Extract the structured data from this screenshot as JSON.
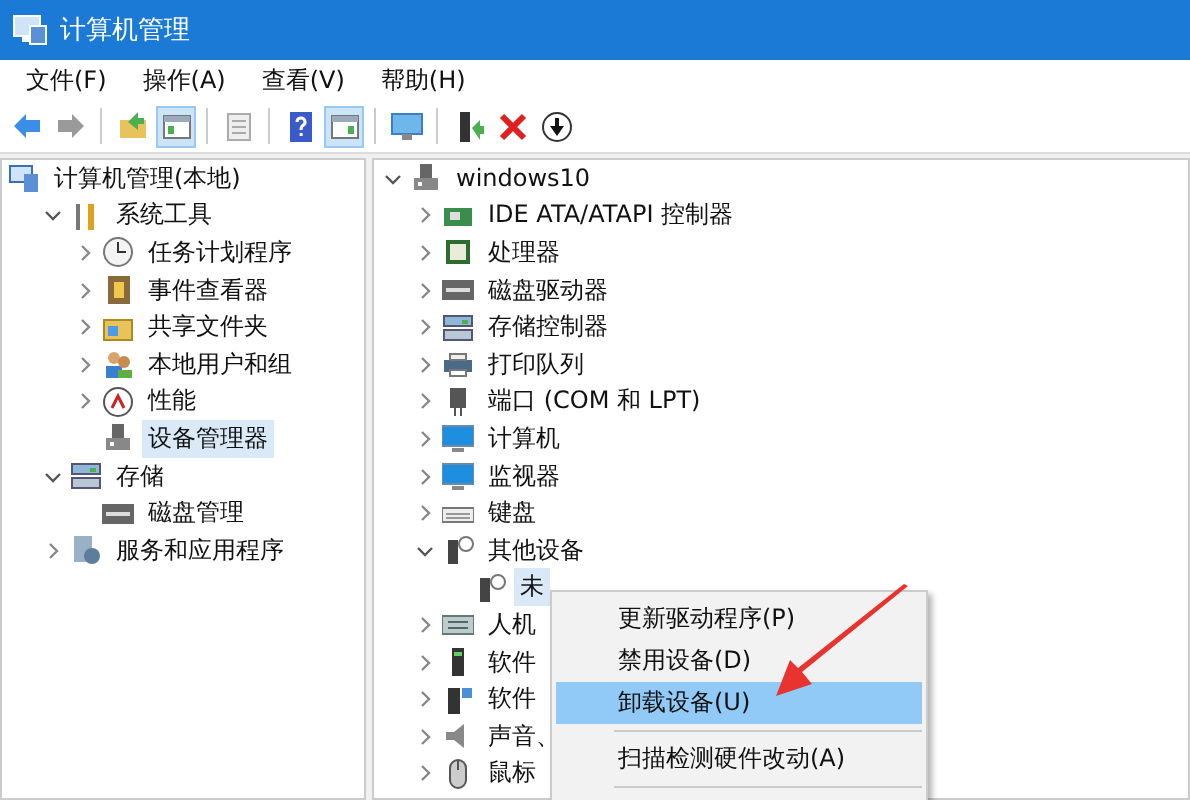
{
  "window": {
    "title": "计算机管理"
  },
  "menu": [
    "文件(F)",
    "操作(A)",
    "查看(V)",
    "帮助(H)"
  ],
  "toolbar": [
    {
      "pressed": false
    },
    {
      "pressed": false
    },
    {
      "pressed": false
    },
    {
      "pressed": true
    },
    {
      "pressed": false
    },
    {
      "pressed": false
    },
    {
      "pressed": true
    },
    {
      "pressed": false
    },
    {
      "pressed": false
    },
    {
      "pressed": false
    },
    {
      "pressed": false
    }
  ],
  "left_tree": [
    {
      "label": "计算机管理(本地)",
      "selected": false,
      "children": [
        {
          "label": "系统工具",
          "expanded": true,
          "selected": false,
          "children": [
            {
              "label": "任务计划程序",
              "expanded": false,
              "selected": false
            },
            {
              "label": "事件查看器",
              "expanded": false,
              "selected": false
            },
            {
              "label": "共享文件夹",
              "expanded": false,
              "selected": false
            },
            {
              "label": "本地用户和组",
              "expanded": false,
              "selected": false
            },
            {
              "label": "性能",
              "expanded": false,
              "selected": false
            },
            {
              "label": "设备管理器",
              "selected": true
            }
          ]
        },
        {
          "label": "存储",
          "expanded": true,
          "selected": false,
          "children": [
            {
              "label": "磁盘管理",
              "selected": false
            }
          ]
        },
        {
          "label": "服务和应用程序",
          "expanded": false,
          "selected": false
        }
      ]
    }
  ],
  "device_tree": [
    {
      "label": "windows10",
      "expanded": true,
      "selected": false,
      "children": [
        {
          "label": "IDE ATA/ATAPI 控制器",
          "expanded": false,
          "selected": false
        },
        {
          "label": "处理器",
          "expanded": false,
          "selected": false
        },
        {
          "label": "磁盘驱动器",
          "expanded": false,
          "selected": false
        },
        {
          "label": "存储控制器",
          "expanded": false,
          "selected": false
        },
        {
          "label": "打印队列",
          "expanded": false,
          "selected": false
        },
        {
          "label": "端口 (COM 和 LPT)",
          "expanded": false,
          "selected": false
        },
        {
          "label": "计算机",
          "expanded": false,
          "selected": false
        },
        {
          "label": "监视器",
          "expanded": false,
          "selected": false
        },
        {
          "label": "键盘",
          "expanded": false,
          "selected": false
        },
        {
          "label": "其他设备",
          "expanded": true,
          "selected": false,
          "children": [
            {
              "label": "未",
              "selected": true
            }
          ]
        },
        {
          "label": "人机",
          "expanded": false,
          "selected": false
        },
        {
          "label": "软件",
          "expanded": false,
          "selected": false
        },
        {
          "label": "软件",
          "expanded": false,
          "selected": false
        },
        {
          "label": "声音、",
          "expanded": false,
          "selected": false
        },
        {
          "label": "鼠标",
          "expanded": false,
          "selected": false
        }
      ]
    }
  ],
  "context_menu": [
    {
      "kind": "item",
      "label": "更新驱动程序(P)",
      "selected": false
    },
    {
      "kind": "item",
      "label": "禁用设备(D)",
      "selected": false
    },
    {
      "kind": "item",
      "label": "卸载设备(U)",
      "selected": true
    },
    {
      "kind": "separator"
    },
    {
      "kind": "item",
      "label": "扫描检测硬件改动(A)",
      "selected": false
    },
    {
      "kind": "separator"
    }
  ]
}
